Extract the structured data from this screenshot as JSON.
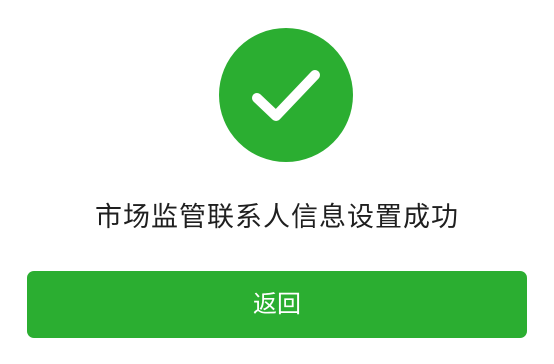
{
  "result": {
    "icon": "checkmark-icon",
    "message": "市场监管联系人信息设置成功"
  },
  "actions": {
    "back_label": "返回"
  },
  "colors": {
    "accent": "#2bae31",
    "text": "#1f1f1f",
    "background": "#ffffff",
    "button_text": "#ffffff"
  }
}
